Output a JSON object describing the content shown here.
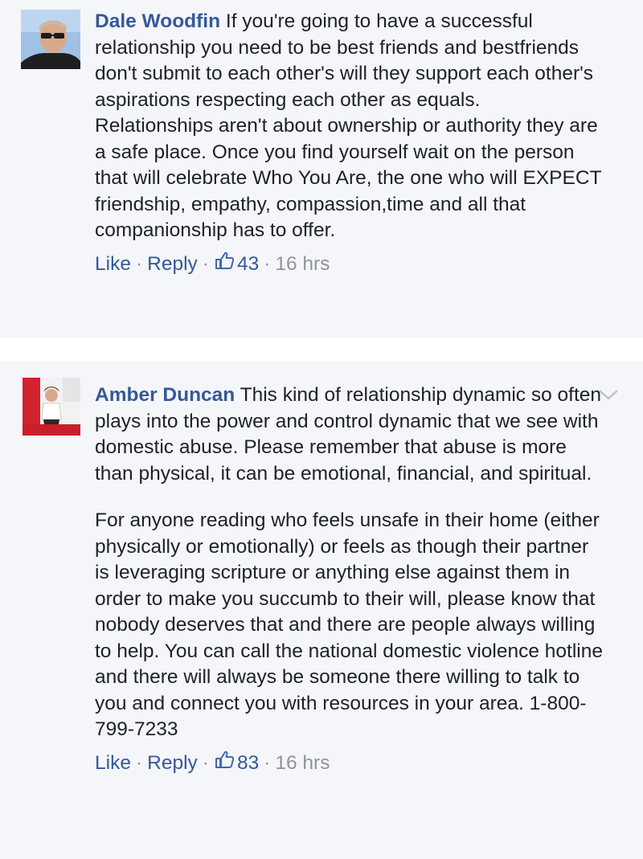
{
  "comments": [
    {
      "author": "Dale Woodfin",
      "paragraphs": [
        "If you're going to have a successful relationship you need to be best friends and bestfriends don't submit to each other's will they support each other's aspirations respecting each other as equals. Relationships aren't about ownership or authority they are a safe place. Once you find yourself wait on the person that will celebrate Who You Are, the one who will EXPECT friendship, empathy, compassion,time and all that companionship has to offer."
      ],
      "like_label": "Like",
      "reply_label": "Reply",
      "likes": "43",
      "time": "16 hrs",
      "separator": "·"
    },
    {
      "author": "Amber Duncan",
      "paragraphs": [
        "This kind of relationship dynamic so often plays into the power and control dynamic that we see with domestic abuse. Please remember that abuse is more than physical, it can be emotional, financial, and spiritual.",
        "For anyone reading who feels unsafe in their home (either physically or emotionally) or feels as though their partner is leveraging scripture or anything else against them in order to make you succumb to their will, please know that nobody deserves that and there are people always willing to help. You can call the national domestic violence hotline and there will always be someone there willing to talk to you and connect you with resources in your area. 1-800-799-7233"
      ],
      "like_label": "Like",
      "reply_label": "Reply",
      "likes": "83",
      "time": "16 hrs",
      "separator": "·"
    }
  ],
  "icons": {
    "like": "thumbs-up-icon",
    "menu": "chevron-down-icon",
    "like_color": "#4267b2"
  },
  "colors": {
    "author": "#365899",
    "text": "#1d2129",
    "meta": "#90949c",
    "background": "#f4f6f9"
  }
}
